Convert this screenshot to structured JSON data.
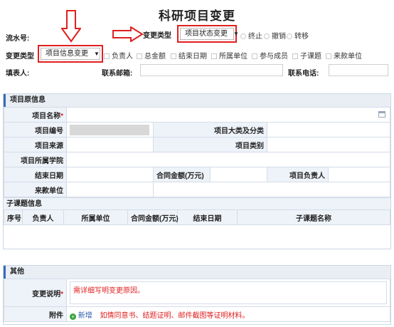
{
  "page": {
    "title": "科研项目变更"
  },
  "top": {
    "serial_label": "流水号:",
    "change_type_label_1": "变更类型",
    "project_state_select": "项目状态变更",
    "state_options": [
      "终止",
      "撤销",
      "转移"
    ],
    "change_type_label_2": "变更类型",
    "project_info_select": "项目信息变更",
    "info_options": [
      "负责人",
      "总金额",
      "结束日期",
      "所属单位",
      "参与成员",
      "子课题",
      "来款单位"
    ],
    "filler_label": "填表人:",
    "email_label": "联系邮箱:",
    "phone_label": "联系电话:"
  },
  "original": {
    "section_title": "项目原信息",
    "project_name_label": "项目名称",
    "project_no_label": "项目编号",
    "category_label": "项目大类及分类",
    "source_label": "项目来源",
    "type_label": "项目类别",
    "college_label": "项目所属学院",
    "end_date_label": "结束日期",
    "contract_amount_label": "合同金额(万元)",
    "leader_label": "项目负责人",
    "payer_label": "来款单位",
    "subtopic_title": "子课题信息",
    "subtopic_columns": [
      "序号",
      "负责人",
      "所属单位",
      "合同金额(万元)",
      "结束日期",
      "子课题名称"
    ]
  },
  "other": {
    "section_title": "其他",
    "reason_label": "变更说明",
    "reason_placeholder": "需详细写明变更原因。",
    "attachment_label": "附件",
    "add_label": "新增",
    "attachment_hint": "如情同意书、结题证明、邮件截图等证明材料。"
  },
  "colors": {
    "annotation_red": "#e02020",
    "section_accent": "#3a6ab8",
    "header_bg": "#e9eef5"
  }
}
